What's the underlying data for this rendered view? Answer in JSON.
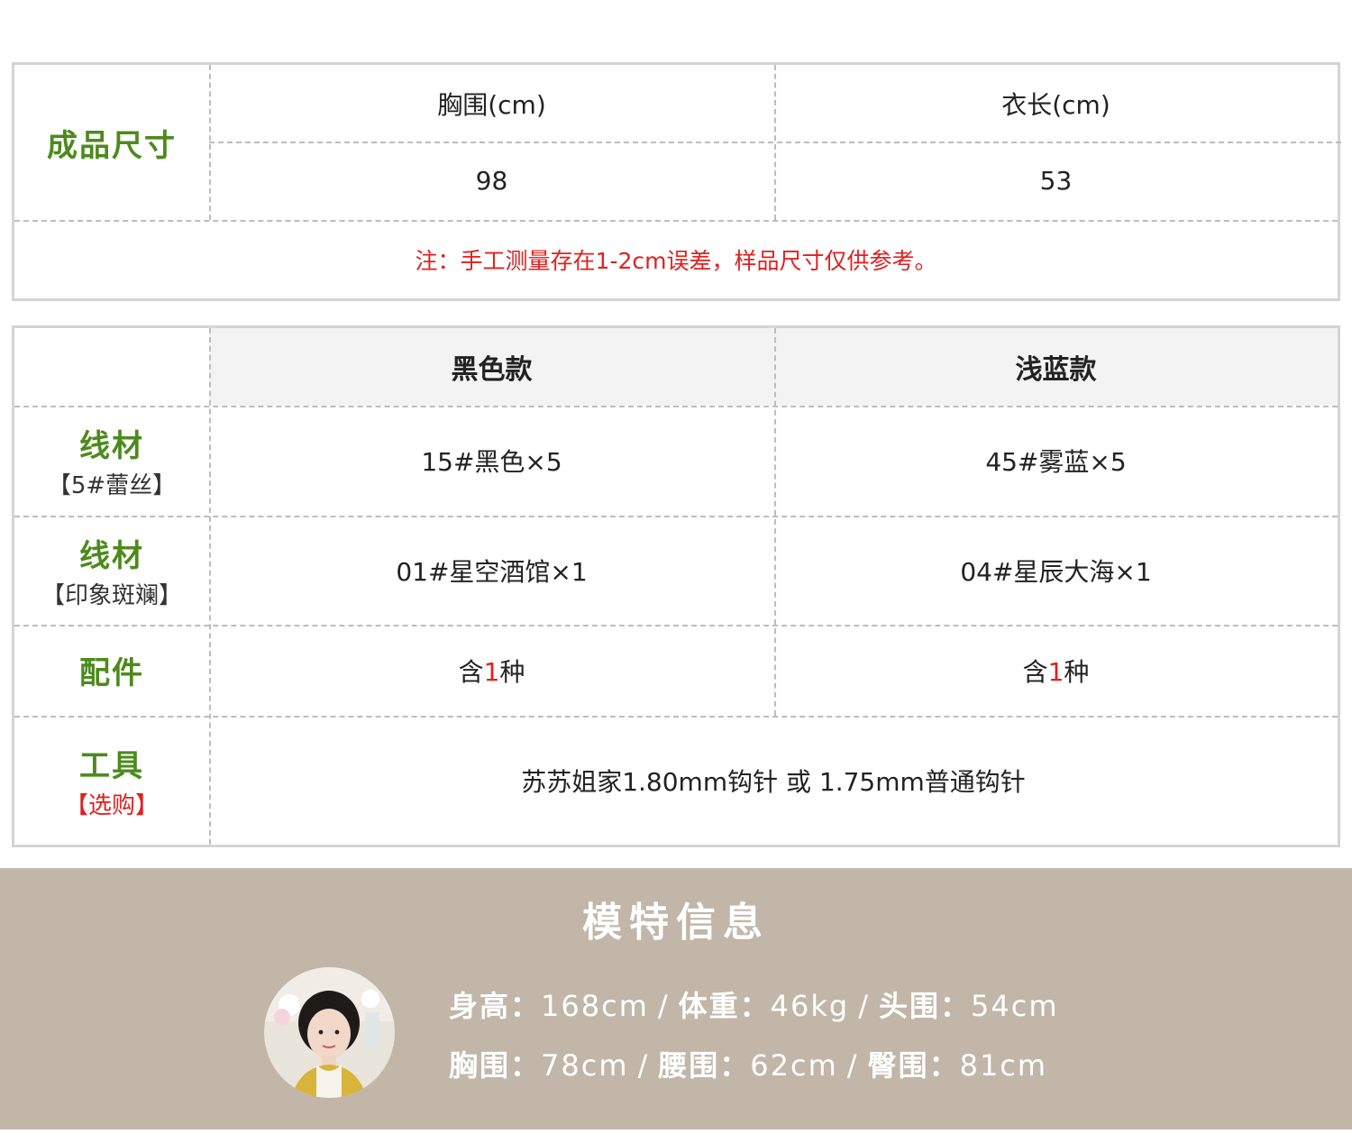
{
  "size_table": {
    "label": "成品尺寸",
    "columns": [
      "胸围(cm)",
      "衣长(cm)"
    ],
    "values": [
      "98",
      "53"
    ],
    "note": "注：手工测量存在1-2cm误差，样品尺寸仅供参考。"
  },
  "material_table": {
    "headers": [
      "黑色款",
      "浅蓝款"
    ],
    "rows": [
      {
        "label": "线材",
        "sub": "【5#蕾丝】",
        "black": "15#黑色×5",
        "blue": "45#雾蓝×5"
      },
      {
        "label": "线材",
        "sub": "【印象斑斓】",
        "black": "01#星空酒馆×1",
        "blue": "04#星辰大海×1"
      }
    ],
    "accessory": {
      "label": "配件",
      "prefix": "含",
      "count": "1",
      "suffix": "种"
    },
    "tool": {
      "label": "工具",
      "sub": "【选购】",
      "value": "苏苏姐家1.80mm钩针 或 1.75mm普通钩针"
    }
  },
  "model_info": {
    "title": "模特信息",
    "height_label": "身高：",
    "height": "168cm",
    "weight_label": "体重：",
    "weight": "46kg",
    "head_label": "头围：",
    "head": "54cm",
    "bust_label": "胸围：",
    "bust": "78cm",
    "waist_label": "腰围：",
    "waist": "62cm",
    "hip_label": "臀围：",
    "hip": "81cm",
    "separator": "/"
  },
  "colors": {
    "label_green": "#4d8a1c",
    "note_red": "#e02020",
    "model_bg": "#c1b6a8",
    "header_bg": "#f3f3f3"
  }
}
